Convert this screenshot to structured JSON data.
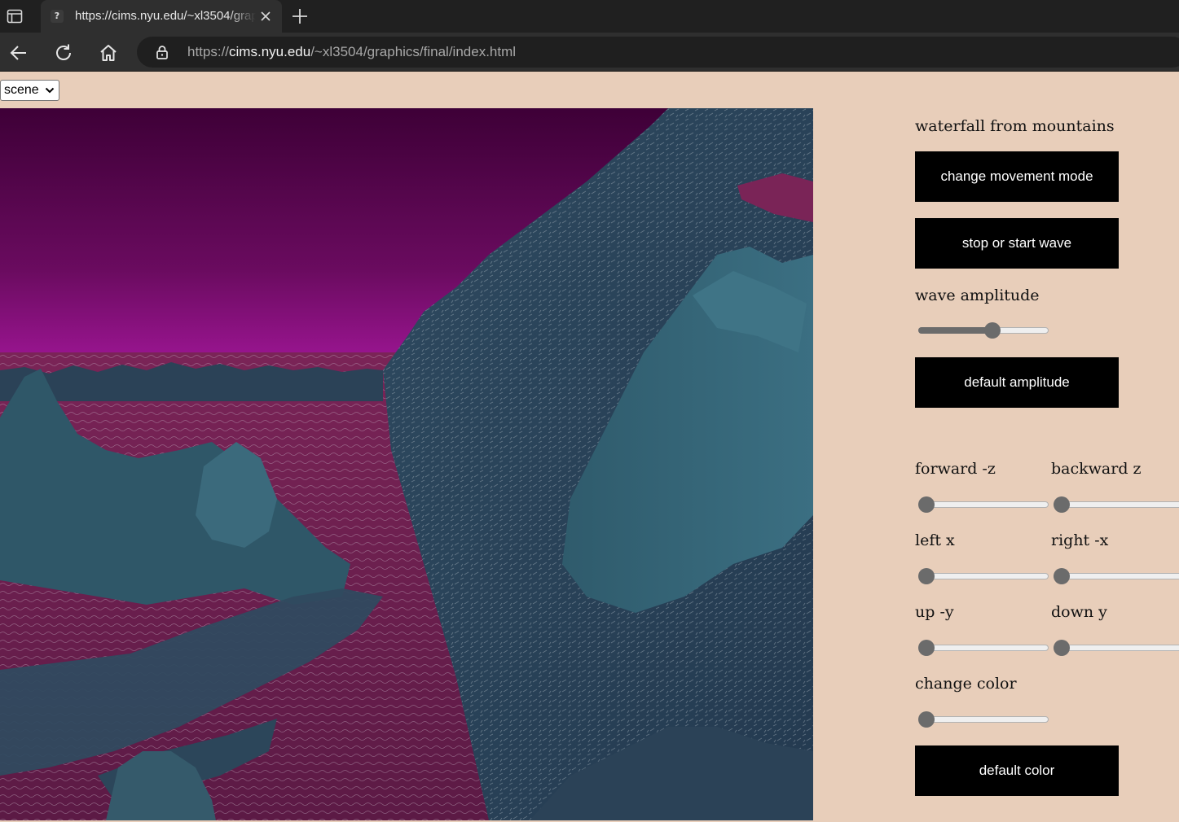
{
  "browser": {
    "tab_title": "https://cims.nyu.edu/~xl3504/graphics/final/index.html",
    "url_scheme": "https://",
    "url_host": "cims.nyu.edu",
    "url_path": "/~xl3504/graphics/final/index.html"
  },
  "scene_select": {
    "selected": "scene"
  },
  "panel": {
    "scene_title": "waterfall from mountains",
    "change_movement_label": "change movement mode",
    "stop_start_wave_label": "stop or start wave",
    "wave_amplitude_label": "wave amplitude",
    "wave_amplitude_value": 0.58,
    "default_amplitude_label": "default amplitude",
    "forward_label": "forward -z",
    "backward_label": "backward z",
    "left_label": "left x",
    "right_label": "right -x",
    "up_label": "up -y",
    "down_label": "down y",
    "change_color_label": "change color",
    "forward_value": 0,
    "backward_value": 0,
    "left_value": 0,
    "right_value": 0,
    "up_value": 0,
    "down_value": 0,
    "change_color_value": 0,
    "default_color_label": "default color"
  },
  "colors": {
    "page_bg": "#e8ceba",
    "sky_top": "#3e0037",
    "sky_bottom": "#a3179a",
    "rock": "#2d4a5e",
    "water": "#6b1e4f"
  }
}
